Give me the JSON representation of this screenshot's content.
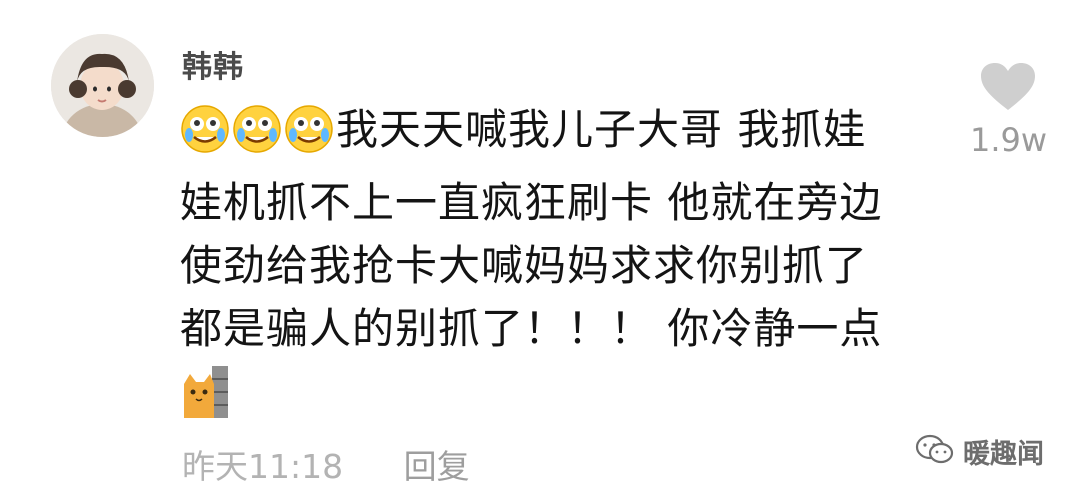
{
  "comment": {
    "username": "韩韩",
    "text_lines": [
      "我天天喊我儿子大哥 我抓娃",
      "娃机抓不上一直疯狂刷卡 他就在旁边",
      "使劲给我抢卡大喊妈妈求求你别抓了",
      "都是骗人的别抓了！！！ 你冷静一点"
    ],
    "leading_emojis": [
      "crying-laughing-emoji-icon",
      "crying-laughing-emoji-icon",
      "crying-laughing-emoji-icon"
    ],
    "sticker": "cat-peeking-wall-icon",
    "timestamp": "昨天11:18",
    "reply_label": "回复"
  },
  "likes": {
    "icon": "heart-icon",
    "count": "1.9w"
  },
  "watermark": {
    "icon": "wechat-official-account-icon",
    "text": "暖趣闻"
  },
  "colors": {
    "username": "#4b4b4b",
    "comment_text": "#141414",
    "meta_text": "#b3b3b3",
    "heart": "#cfcfcf"
  }
}
